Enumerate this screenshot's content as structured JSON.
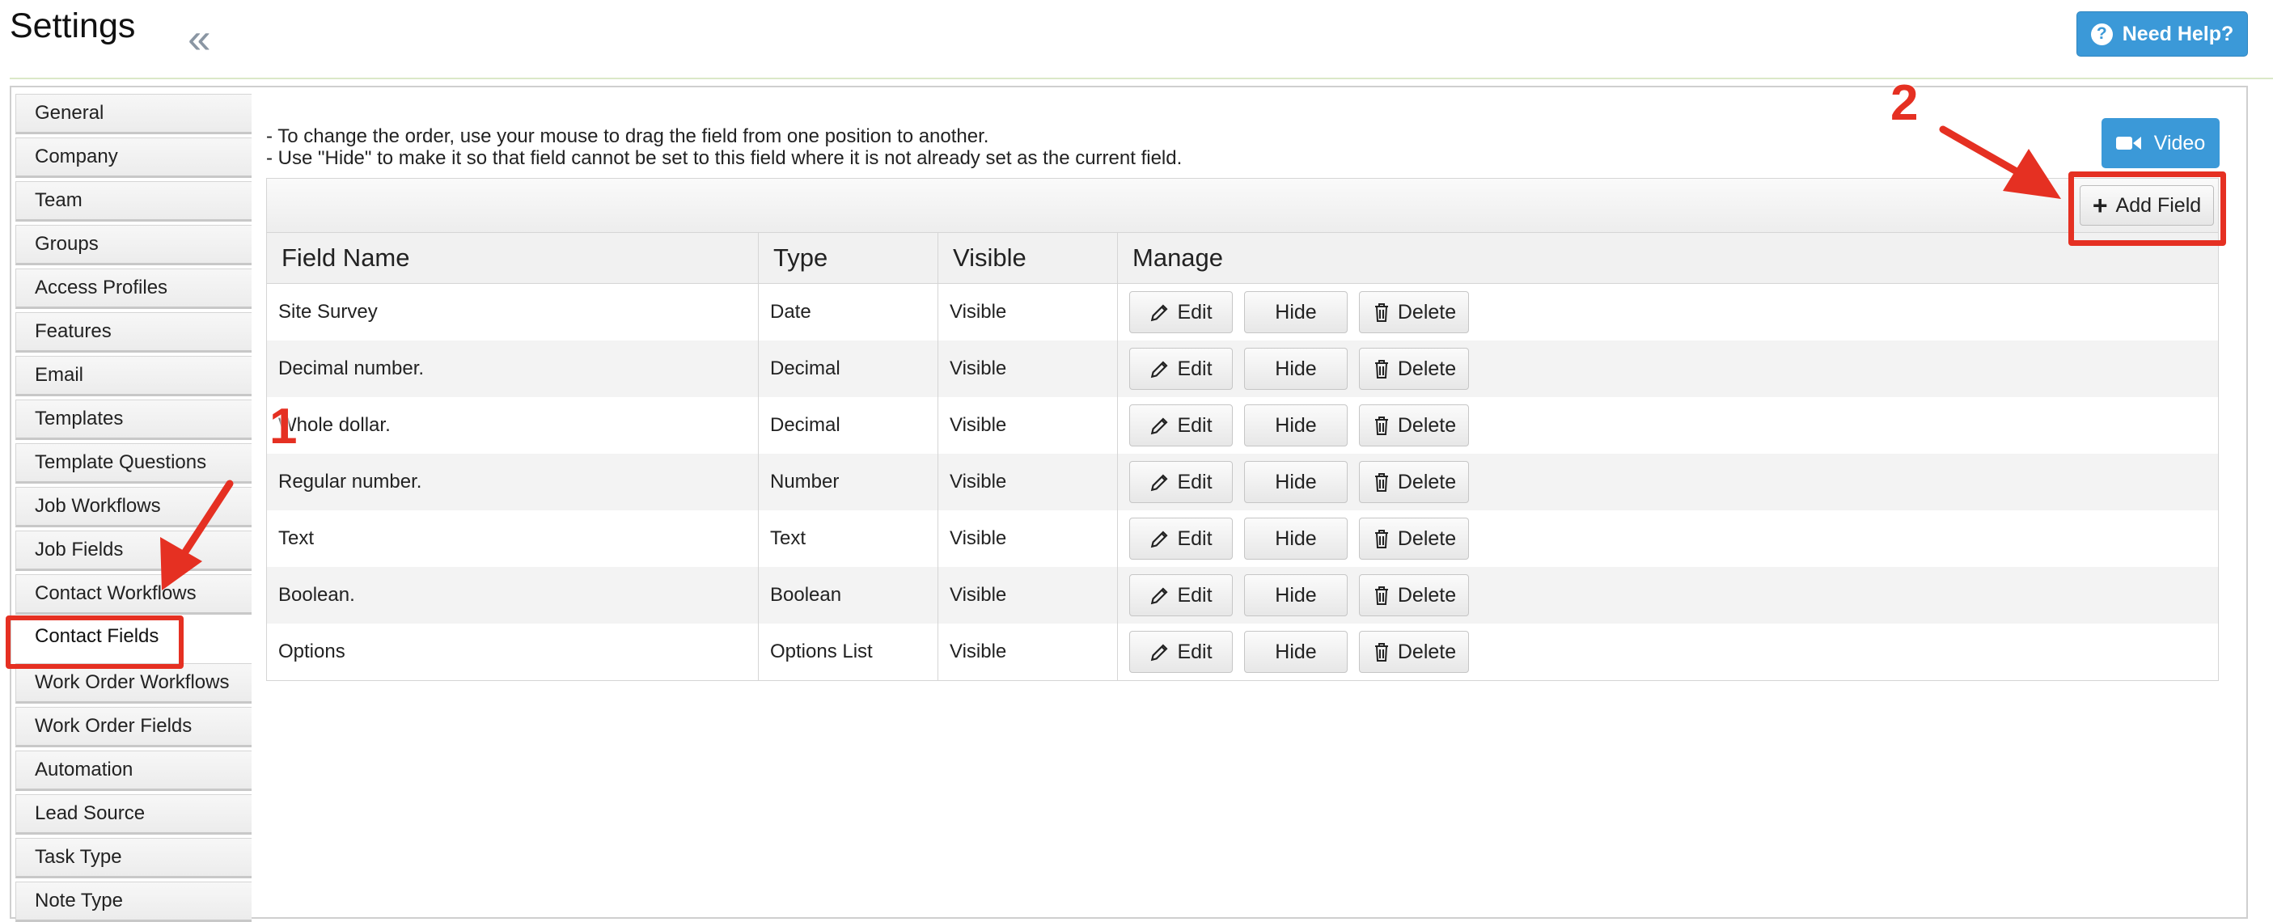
{
  "header": {
    "title": "Settings",
    "collapse_icon": "double-chevron-left-icon",
    "help_label": "Need Help?",
    "help_icon": "question-circle-icon"
  },
  "sidebar": {
    "items": [
      {
        "label": "General"
      },
      {
        "label": "Company"
      },
      {
        "label": "Team"
      },
      {
        "label": "Groups"
      },
      {
        "label": "Access Profiles"
      },
      {
        "label": "Features"
      },
      {
        "label": "Email"
      },
      {
        "label": "Templates"
      },
      {
        "label": "Template Questions"
      },
      {
        "label": "Job Workflows"
      },
      {
        "label": "Job Fields"
      },
      {
        "label": "Contact Workflows"
      },
      {
        "label": "Contact Fields",
        "active": true
      },
      {
        "label": "Work Order Workflows"
      },
      {
        "label": "Work Order Fields"
      },
      {
        "label": "Automation"
      },
      {
        "label": "Lead Source"
      },
      {
        "label": "Task Type"
      },
      {
        "label": "Note Type"
      }
    ]
  },
  "main": {
    "notes": [
      "- To change the order, use your mouse to drag the field from one position to another.",
      "- Use \"Hide\" to make it so that field cannot be set to this field where it is not already set as the current field."
    ],
    "video_label": "Video",
    "video_icon": "video-camera-icon",
    "add_field_label": "Add Field",
    "columns": [
      "Field Name",
      "Type",
      "Visible",
      "Manage"
    ],
    "rows": [
      {
        "name": "Site Survey",
        "type": "Date",
        "visible": "Visible"
      },
      {
        "name": "Decimal number.",
        "type": "Decimal",
        "visible": "Visible"
      },
      {
        "name": "Whole dollar.",
        "type": "Decimal",
        "visible": "Visible"
      },
      {
        "name": "Regular number.",
        "type": "Number",
        "visible": "Visible"
      },
      {
        "name": "Text",
        "type": "Text",
        "visible": "Visible"
      },
      {
        "name": "Boolean.",
        "type": "Boolean",
        "visible": "Visible"
      },
      {
        "name": "Options",
        "type": "Options List",
        "visible": "Visible"
      }
    ],
    "actions": {
      "edit": "Edit",
      "hide": "Hide",
      "delete": "Delete"
    }
  },
  "annotations": {
    "step1": "1",
    "step2": "2",
    "color": "#e53022"
  },
  "colors": {
    "accent": "#3b99d8",
    "annotation": "#e53022"
  }
}
